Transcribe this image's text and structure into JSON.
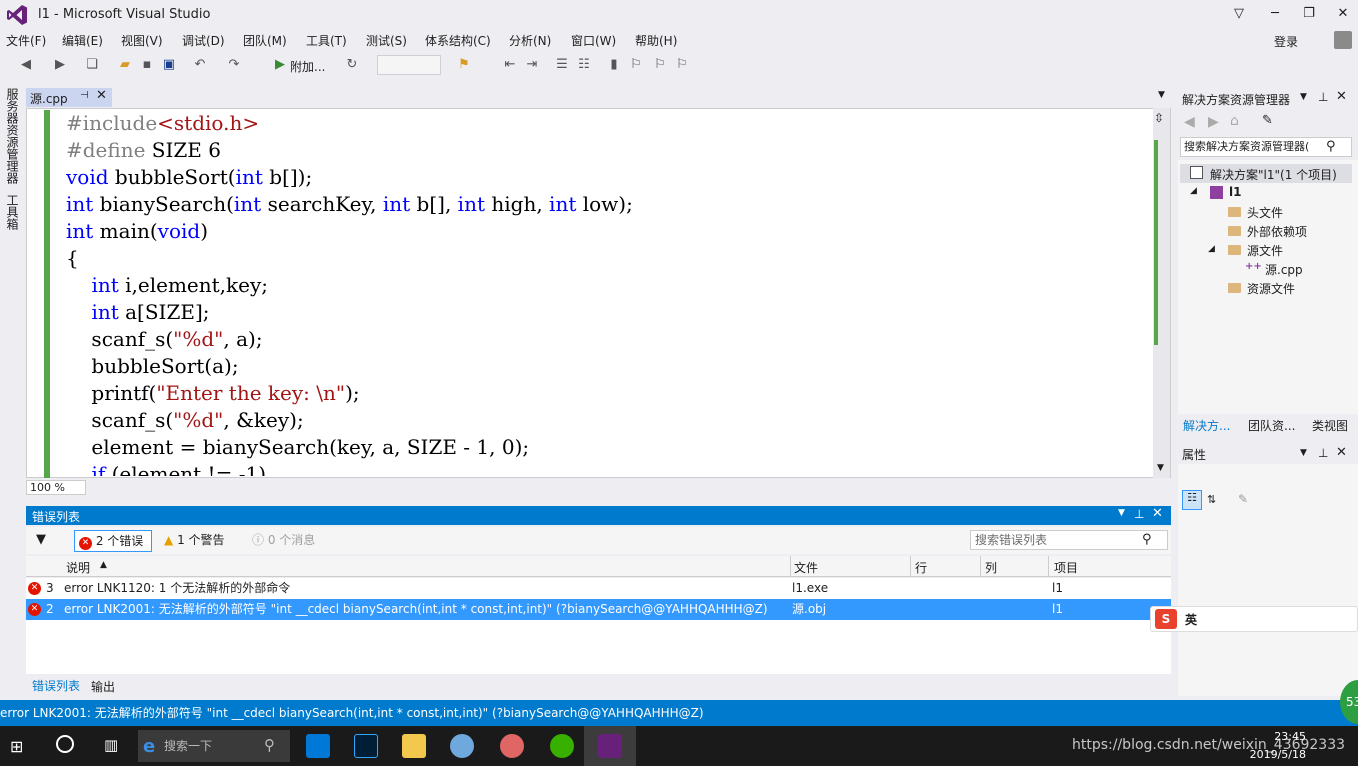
{
  "window": {
    "title": "l1 - Microsoft Visual Studio",
    "login_label": "登录"
  },
  "menu": [
    "文件(F)",
    "编辑(E)",
    "视图(V)",
    "调试(D)",
    "团队(M)",
    "工具(T)",
    "测试(S)",
    "体系结构(C)",
    "分析(N)",
    "窗口(W)",
    "帮助(H)"
  ],
  "toolbar": {
    "attach_label": "附加...",
    "icons": [
      "back-icon",
      "forward-icon",
      "new-project-icon",
      "open-icon",
      "save-icon",
      "save-all-icon",
      "undo-icon",
      "redo-icon",
      "start-icon",
      "refresh-icon",
      "find-icon",
      "comment-icon",
      "uncomment-icon",
      "bookmark-icon"
    ]
  },
  "left_strip": {
    "server_explorer": "服务器资源管理器",
    "toolbox": "工具箱"
  },
  "editor": {
    "tab_label": "源.cpp",
    "zoom": "100 %",
    "code_lines": [
      [
        {
          "t": "#include",
          "c": "pp"
        },
        {
          "t": "<stdio.h>",
          "c": "str"
        }
      ],
      [
        {
          "t": "#define",
          "c": "pp"
        },
        {
          "t": " SIZE 6",
          "c": ""
        }
      ],
      [
        {
          "t": "void",
          "c": "kw"
        },
        {
          "t": " bubbleSort(",
          "c": ""
        },
        {
          "t": "int",
          "c": "kw"
        },
        {
          "t": " b[]);",
          "c": ""
        }
      ],
      [
        {
          "t": "int",
          "c": "kw"
        },
        {
          "t": " bianySearch(",
          "c": ""
        },
        {
          "t": "int",
          "c": "kw"
        },
        {
          "t": " searchKey, ",
          "c": ""
        },
        {
          "t": "int",
          "c": "kw"
        },
        {
          "t": " b[], ",
          "c": ""
        },
        {
          "t": "int",
          "c": "kw"
        },
        {
          "t": " high, ",
          "c": ""
        },
        {
          "t": "int",
          "c": "kw"
        },
        {
          "t": " low);",
          "c": ""
        }
      ],
      [
        {
          "t": "int",
          "c": "kw"
        },
        {
          "t": " main(",
          "c": ""
        },
        {
          "t": "void",
          "c": "kw"
        },
        {
          "t": ")",
          "c": ""
        }
      ],
      [
        {
          "t": "{",
          "c": ""
        }
      ],
      [
        {
          "t": "    ",
          "c": ""
        },
        {
          "t": "int",
          "c": "kw"
        },
        {
          "t": " i,element,key;",
          "c": ""
        }
      ],
      [
        {
          "t": "    ",
          "c": ""
        },
        {
          "t": "int",
          "c": "kw"
        },
        {
          "t": " a[SIZE];",
          "c": ""
        }
      ],
      [
        {
          "t": "    scanf_s(",
          "c": ""
        },
        {
          "t": "\"%d\"",
          "c": "str"
        },
        {
          "t": ", a);",
          "c": ""
        }
      ],
      [
        {
          "t": "    bubbleSort(a);",
          "c": ""
        }
      ],
      [
        {
          "t": "    printf(",
          "c": ""
        },
        {
          "t": "\"Enter the key: \\n\"",
          "c": "str"
        },
        {
          "t": ");",
          "c": ""
        }
      ],
      [
        {
          "t": "    scanf_s(",
          "c": ""
        },
        {
          "t": "\"%d\"",
          "c": "str"
        },
        {
          "t": ", &key);",
          "c": ""
        }
      ],
      [
        {
          "t": "    element = bianySearch(key, a, SIZE - 1, 0);",
          "c": ""
        }
      ],
      [
        {
          "t": "    ",
          "c": ""
        },
        {
          "t": "if",
          "c": "kw"
        },
        {
          "t": " (element != -1)",
          "c": ""
        }
      ]
    ]
  },
  "error_list": {
    "title": "错误列表",
    "errors_btn": "2 个错误",
    "warnings_btn": "1 个警告",
    "messages_btn": "0 个消息",
    "search_placeholder": "搜索错误列表",
    "columns": [
      "说明",
      "文件",
      "行",
      "列",
      "项目"
    ],
    "rows": [
      {
        "num": "3",
        "desc": "error LNK1120: 1 个无法解析的外部命令",
        "file": "l1.exe",
        "line": "",
        "col": "",
        "project": "l1"
      },
      {
        "num": "2",
        "desc": "error LNK2001: 无法解析的外部符号 \"int __cdecl bianySearch(int,int * const,int,int)\" (?bianySearch@@YAHHQAHHH@Z)",
        "file": "源.obj",
        "line": "",
        "col": "",
        "project": "l1"
      }
    ],
    "bottom_tabs": [
      "错误列表",
      "输出"
    ]
  },
  "solution_explorer": {
    "title": "解决方案资源管理器",
    "search_placeholder": "搜索解决方案资源管理器(",
    "tree": [
      {
        "label": "解决方案\"l1\"(1 个项目)",
        "level": 0
      },
      {
        "label": "l1",
        "level": 1
      },
      {
        "label": "头文件",
        "level": 2
      },
      {
        "label": "外部依赖项",
        "level": 2
      },
      {
        "label": "源文件",
        "level": 2
      },
      {
        "label": "源.cpp",
        "level": 3
      },
      {
        "label": "资源文件",
        "level": 2
      }
    ],
    "tabs": [
      "解决方...",
      "团队资...",
      "类视图"
    ]
  },
  "properties": {
    "title": "属性"
  },
  "status_bar": {
    "text": "error LNK2001: 无法解析的外部符号 \"int __cdecl bianySearch(int,int * const,int,int)\" (?bianySearch@@YAHHQAHHH@Z)"
  },
  "taskbar": {
    "search_placeholder": "搜索一下",
    "time": "23:45",
    "date": "2019/5/18",
    "watermark": "https://blog.csdn.net/weixin_43692333",
    "ime_label": "英",
    "badge": "53"
  },
  "colors": {
    "accent": "#007acc",
    "selection": "#3399ff",
    "keyword": "#0000ff",
    "string": "#a31515",
    "error": "#e51400"
  }
}
